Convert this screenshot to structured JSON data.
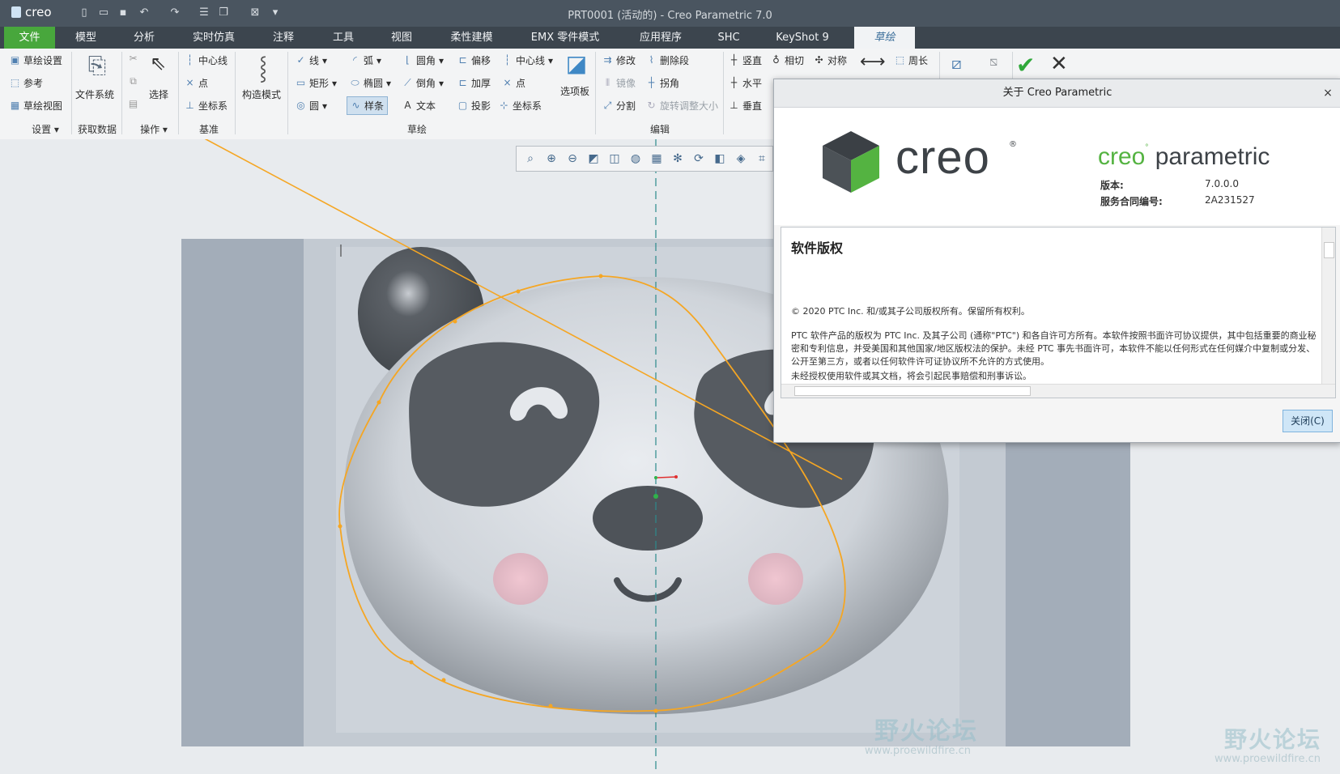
{
  "app": {
    "brand": "creo",
    "window_title": "PRT0001 (活动的) - Creo Parametric 7.0"
  },
  "tabs": [
    "文件",
    "模型",
    "分析",
    "实时仿真",
    "注释",
    "工具",
    "视图",
    "柔性建模",
    "EMX 零件模式",
    "应用程序",
    "SHC",
    "KeyShot 9",
    "草绘"
  ],
  "ribbon": {
    "setup": {
      "items": [
        "草绘设置",
        "参考",
        "草绘视图"
      ],
      "group": "设置"
    },
    "get_data": {
      "label": "文件系统",
      "group": "获取数据"
    },
    "operations": {
      "select": "选择",
      "group": "操作"
    },
    "datum": {
      "items": [
        "中心线",
        "点",
        "坐标系"
      ],
      "group": "基准"
    },
    "construction": {
      "label": "构造模式"
    },
    "sketch": {
      "col1": [
        "线",
        "矩形",
        "圆"
      ],
      "col2": [
        "弧",
        "椭圆",
        "样条"
      ],
      "col3": [
        "圆角",
        "倒角",
        "文本"
      ],
      "col4": [
        "偏移",
        "加厚",
        "投影"
      ],
      "col5": [
        "中心线",
        "点",
        "坐标系"
      ],
      "palette": "选项板",
      "group": "草绘"
    },
    "edit": {
      "items": [
        "修改",
        "删除段",
        "镜像",
        "拐角",
        "分割",
        "旋转调整大小"
      ],
      "group": "编辑"
    },
    "constrain": {
      "items": [
        "竖直",
        "相切",
        "对称",
        "水平",
        "垂直"
      ]
    },
    "dimension": {
      "label": "周长"
    }
  },
  "dialog": {
    "title": "关于 Creo Parametric",
    "logo_text": "creo",
    "product": "parametric",
    "version_label": "版本:",
    "version_value": "7.0.0.0",
    "contract_label": "服务合同编号:",
    "contract_value": "2A231527",
    "section_title": "软件版权",
    "copyright": "© 2020 PTC Inc. 和/或其子公司版权所有。保留所有权利。",
    "para1": "PTC 软件产品的版权为 PTC Inc. 及其子公司 (通称\"PTC\") 和各自许可方所有。本软件按照书面许可协议提供，其中包括重要的商业秘密和专利信息，并受美国和其他国家/地区版权法的保护。未经 PTC 事先书面许可，本软件不能以任何形式在任何媒介中复制或分发、公开至第三方，或者以任何软件许可证协议所不允许的方式使用。",
    "para2": "未经授权使用软件或其文档，将会引起民事赔偿和刑事诉讼。",
    "close_button": "关闭(C)"
  },
  "watermark": {
    "name": "野火论坛",
    "url": "www.proewildfire.cn"
  },
  "colors": {
    "spline": "#f5a623",
    "accent_green": "#48a73c",
    "tab_bg": "#3c454e"
  }
}
